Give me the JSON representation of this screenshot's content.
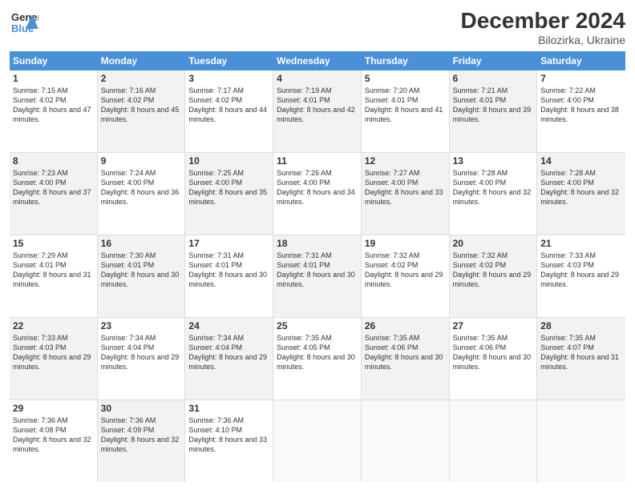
{
  "header": {
    "logo_line1": "General",
    "logo_line2": "Blue",
    "title": "December 2024",
    "subtitle": "Bilozirka, Ukraine"
  },
  "days_of_week": [
    "Sunday",
    "Monday",
    "Tuesday",
    "Wednesday",
    "Thursday",
    "Friday",
    "Saturday"
  ],
  "weeks": [
    [
      {
        "day": "1",
        "info": "Sunrise: 7:15 AM\nSunset: 4:02 PM\nDaylight: 8 hours and 47 minutes.",
        "empty": false,
        "alt": false
      },
      {
        "day": "2",
        "info": "Sunrise: 7:16 AM\nSunset: 4:02 PM\nDaylight: 8 hours and 45 minutes.",
        "empty": false,
        "alt": true
      },
      {
        "day": "3",
        "info": "Sunrise: 7:17 AM\nSunset: 4:02 PM\nDaylight: 8 hours and 44 minutes.",
        "empty": false,
        "alt": false
      },
      {
        "day": "4",
        "info": "Sunrise: 7:19 AM\nSunset: 4:01 PM\nDaylight: 8 hours and 42 minutes.",
        "empty": false,
        "alt": true
      },
      {
        "day": "5",
        "info": "Sunrise: 7:20 AM\nSunset: 4:01 PM\nDaylight: 8 hours and 41 minutes.",
        "empty": false,
        "alt": false
      },
      {
        "day": "6",
        "info": "Sunrise: 7:21 AM\nSunset: 4:01 PM\nDaylight: 8 hours and 39 minutes.",
        "empty": false,
        "alt": true
      },
      {
        "day": "7",
        "info": "Sunrise: 7:22 AM\nSunset: 4:00 PM\nDaylight: 8 hours and 38 minutes.",
        "empty": false,
        "alt": false
      }
    ],
    [
      {
        "day": "8",
        "info": "Sunrise: 7:23 AM\nSunset: 4:00 PM\nDaylight: 8 hours and 37 minutes.",
        "empty": false,
        "alt": true
      },
      {
        "day": "9",
        "info": "Sunrise: 7:24 AM\nSunset: 4:00 PM\nDaylight: 8 hours and 36 minutes.",
        "empty": false,
        "alt": false
      },
      {
        "day": "10",
        "info": "Sunrise: 7:25 AM\nSunset: 4:00 PM\nDaylight: 8 hours and 35 minutes.",
        "empty": false,
        "alt": true
      },
      {
        "day": "11",
        "info": "Sunrise: 7:26 AM\nSunset: 4:00 PM\nDaylight: 8 hours and 34 minutes.",
        "empty": false,
        "alt": false
      },
      {
        "day": "12",
        "info": "Sunrise: 7:27 AM\nSunset: 4:00 PM\nDaylight: 8 hours and 33 minutes.",
        "empty": false,
        "alt": true
      },
      {
        "day": "13",
        "info": "Sunrise: 7:28 AM\nSunset: 4:00 PM\nDaylight: 8 hours and 32 minutes.",
        "empty": false,
        "alt": false
      },
      {
        "day": "14",
        "info": "Sunrise: 7:28 AM\nSunset: 4:00 PM\nDaylight: 8 hours and 32 minutes.",
        "empty": false,
        "alt": true
      }
    ],
    [
      {
        "day": "15",
        "info": "Sunrise: 7:29 AM\nSunset: 4:01 PM\nDaylight: 8 hours and 31 minutes.",
        "empty": false,
        "alt": false
      },
      {
        "day": "16",
        "info": "Sunrise: 7:30 AM\nSunset: 4:01 PM\nDaylight: 8 hours and 30 minutes.",
        "empty": false,
        "alt": true
      },
      {
        "day": "17",
        "info": "Sunrise: 7:31 AM\nSunset: 4:01 PM\nDaylight: 8 hours and 30 minutes.",
        "empty": false,
        "alt": false
      },
      {
        "day": "18",
        "info": "Sunrise: 7:31 AM\nSunset: 4:01 PM\nDaylight: 8 hours and 30 minutes.",
        "empty": false,
        "alt": true
      },
      {
        "day": "19",
        "info": "Sunrise: 7:32 AM\nSunset: 4:02 PM\nDaylight: 8 hours and 29 minutes.",
        "empty": false,
        "alt": false
      },
      {
        "day": "20",
        "info": "Sunrise: 7:32 AM\nSunset: 4:02 PM\nDaylight: 8 hours and 29 minutes.",
        "empty": false,
        "alt": true
      },
      {
        "day": "21",
        "info": "Sunrise: 7:33 AM\nSunset: 4:03 PM\nDaylight: 8 hours and 29 minutes.",
        "empty": false,
        "alt": false
      }
    ],
    [
      {
        "day": "22",
        "info": "Sunrise: 7:33 AM\nSunset: 4:03 PM\nDaylight: 8 hours and 29 minutes.",
        "empty": false,
        "alt": true
      },
      {
        "day": "23",
        "info": "Sunrise: 7:34 AM\nSunset: 4:04 PM\nDaylight: 8 hours and 29 minutes.",
        "empty": false,
        "alt": false
      },
      {
        "day": "24",
        "info": "Sunrise: 7:34 AM\nSunset: 4:04 PM\nDaylight: 8 hours and 29 minutes.",
        "empty": false,
        "alt": true
      },
      {
        "day": "25",
        "info": "Sunrise: 7:35 AM\nSunset: 4:05 PM\nDaylight: 8 hours and 30 minutes.",
        "empty": false,
        "alt": false
      },
      {
        "day": "26",
        "info": "Sunrise: 7:35 AM\nSunset: 4:06 PM\nDaylight: 8 hours and 30 minutes.",
        "empty": false,
        "alt": true
      },
      {
        "day": "27",
        "info": "Sunrise: 7:35 AM\nSunset: 4:06 PM\nDaylight: 8 hours and 30 minutes.",
        "empty": false,
        "alt": false
      },
      {
        "day": "28",
        "info": "Sunrise: 7:35 AM\nSunset: 4:07 PM\nDaylight: 8 hours and 31 minutes.",
        "empty": false,
        "alt": true
      }
    ],
    [
      {
        "day": "29",
        "info": "Sunrise: 7:36 AM\nSunset: 4:08 PM\nDaylight: 8 hours and 32 minutes.",
        "empty": false,
        "alt": false
      },
      {
        "day": "30",
        "info": "Sunrise: 7:36 AM\nSunset: 4:09 PM\nDaylight: 8 hours and 32 minutes.",
        "empty": false,
        "alt": true
      },
      {
        "day": "31",
        "info": "Sunrise: 7:36 AM\nSunset: 4:10 PM\nDaylight: 8 hours and 33 minutes.",
        "empty": false,
        "alt": false
      },
      {
        "day": "",
        "info": "",
        "empty": true,
        "alt": false
      },
      {
        "day": "",
        "info": "",
        "empty": true,
        "alt": false
      },
      {
        "day": "",
        "info": "",
        "empty": true,
        "alt": false
      },
      {
        "day": "",
        "info": "",
        "empty": true,
        "alt": false
      }
    ]
  ]
}
